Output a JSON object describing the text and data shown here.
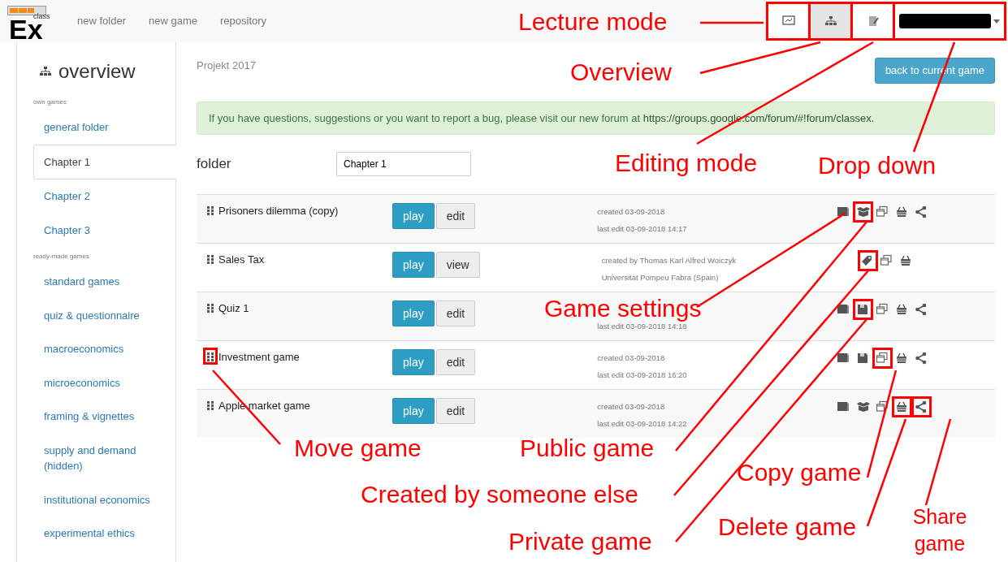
{
  "logo": {
    "small": "class",
    "big": "Ex"
  },
  "nav": [
    "new folder",
    "new game",
    "repository"
  ],
  "modes": [
    {
      "kind": "lecture",
      "selected": false,
      "highlighted": true
    },
    {
      "kind": "overview",
      "selected": true,
      "highlighted": true
    },
    {
      "kind": "editing",
      "selected": false,
      "highlighted": true
    }
  ],
  "user_dropdown": {
    "highlighted": true
  },
  "sidebar": {
    "title": "overview",
    "sections": [
      {
        "heading": "own games",
        "items": [
          {
            "label": "general folder",
            "selected": false
          },
          {
            "label": "Chapter 1",
            "selected": true
          },
          {
            "label": "Chapter 2",
            "selected": false
          },
          {
            "label": "Chapter 3",
            "selected": false
          }
        ]
      },
      {
        "heading": "ready-made games",
        "items": [
          {
            "label": "standard games",
            "selected": false
          },
          {
            "label": "quiz & questionnaire",
            "selected": false
          },
          {
            "label": "macroeconomics",
            "selected": false
          },
          {
            "label": "microeconomics",
            "selected": false
          },
          {
            "label": "framing & vignettes",
            "selected": false
          },
          {
            "label": "supply and demand (hidden)",
            "selected": false
          },
          {
            "label": "institutional economics",
            "selected": false
          },
          {
            "label": "experimental ethics",
            "selected": false
          }
        ]
      }
    ]
  },
  "project": "Projekt 2017",
  "back_button": "back to current game",
  "alert": {
    "text": "If you have questions, suggestions or you want to report a bug, please visit our new forum at ",
    "link": "https://groups.google.com/forum/#!forum/classex."
  },
  "folder": {
    "label": "folder",
    "value": "Chapter 1"
  },
  "games": [
    {
      "name": "Prisoners dilemma (copy)",
      "handle_highlighted": false,
      "buttons": [
        {
          "label": "play",
          "kind": "primary"
        },
        {
          "label": "edit",
          "kind": "default"
        }
      ],
      "meta_top": "created 03-09-2018",
      "meta_bottom": "last edit 03-09-2018 14:17",
      "icons": [
        {
          "kind": "settings",
          "highlighted": false
        },
        {
          "kind": "public",
          "highlighted": true
        },
        {
          "kind": "copy",
          "highlighted": false
        },
        {
          "kind": "delete",
          "highlighted": false
        },
        {
          "kind": "share",
          "highlighted": false
        }
      ]
    },
    {
      "name": "Sales Tax",
      "handle_highlighted": false,
      "buttons": [
        {
          "label": "play",
          "kind": "primary"
        },
        {
          "label": "view",
          "kind": "default"
        }
      ],
      "meta_top": "created by Thomas Karl Alfred Woiczyk",
      "meta_bottom": "Universitat Pompeu Fabra (Spain)",
      "icons": [
        {
          "kind": "foreign",
          "highlighted": true
        },
        {
          "kind": "copy",
          "highlighted": false
        },
        {
          "kind": "delete",
          "highlighted": false
        }
      ]
    },
    {
      "name": "Quiz 1",
      "handle_highlighted": false,
      "buttons": [
        {
          "label": "play",
          "kind": "primary"
        },
        {
          "label": "edit",
          "kind": "default"
        }
      ],
      "meta_bottom": "last edit 03-09-2018 14:18",
      "icons": [
        {
          "kind": "settings",
          "highlighted": false
        },
        {
          "kind": "private",
          "highlighted": true
        },
        {
          "kind": "copy",
          "highlighted": false
        },
        {
          "kind": "delete",
          "highlighted": false
        },
        {
          "kind": "share",
          "highlighted": false
        }
      ]
    },
    {
      "name": "Investment game",
      "handle_highlighted": true,
      "buttons": [
        {
          "label": "play",
          "kind": "primary"
        },
        {
          "label": "edit",
          "kind": "default"
        }
      ],
      "meta_top": "created 03-09-2018",
      "meta_bottom": "last edit 03-09-2018 16:20",
      "icons": [
        {
          "kind": "settings",
          "highlighted": false
        },
        {
          "kind": "private",
          "highlighted": false
        },
        {
          "kind": "copy",
          "highlighted": true
        },
        {
          "kind": "delete",
          "highlighted": false
        },
        {
          "kind": "share",
          "highlighted": false
        }
      ]
    },
    {
      "name": "Apple market game",
      "handle_highlighted": false,
      "buttons": [
        {
          "label": "play",
          "kind": "primary"
        },
        {
          "label": "edit",
          "kind": "default"
        }
      ],
      "meta_top": "created 03-09-2018",
      "meta_bottom": "last edit 03-09-2018 14:22",
      "icons": [
        {
          "kind": "settings",
          "highlighted": false
        },
        {
          "kind": "public",
          "highlighted": false
        },
        {
          "kind": "copy",
          "highlighted": false
        },
        {
          "kind": "delete",
          "highlighted": true
        },
        {
          "kind": "share",
          "highlighted": true
        }
      ]
    }
  ],
  "annotations": [
    "Lecture mode",
    "Overview",
    "Editing mode",
    "Drop down",
    "Game settings",
    "Move game",
    "Public game",
    "Created by someone else",
    "Private game",
    "Copy game",
    "Delete game",
    "Share game"
  ]
}
